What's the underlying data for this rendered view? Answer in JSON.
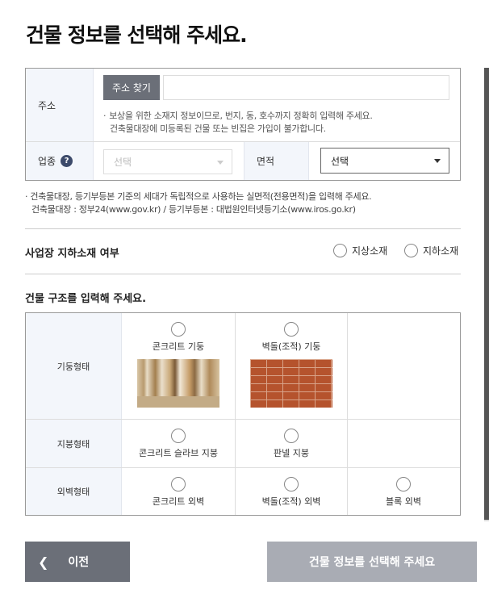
{
  "page": {
    "title": "건물 정보를 선택해 주세요."
  },
  "address": {
    "label": "주소",
    "search_button": "주소 찾기",
    "input_value": "",
    "notes": [
      "보상을 위한 소재지 정보이므로, 번지, 동, 호수까지 정확히 입력해 주세요.",
      "건축물대장에 미등록된 건물 또는 빈집은 가입이 불가합니다."
    ]
  },
  "industry": {
    "label": "업종",
    "help_icon": "question-circle-icon",
    "select_value": "선택"
  },
  "area": {
    "label": "면적",
    "select_value": "선택"
  },
  "area_note": [
    "건축물대장, 등기부등본 기준의 세대가 독립적으로 사용하는 실면적(전용면적)을 입력해 주세요.",
    "건축물대장 : 정부24(www.gov.kr) / 등기부등본 : 대법원인터넷등기소(www.iros.go.kr)"
  ],
  "basement": {
    "title": "사업장 지하소재 여부",
    "options": [
      "지상소재",
      "지하소재"
    ]
  },
  "structure": {
    "title": "건물 구조를 입력해 주세요.",
    "rows": [
      {
        "label": "기둥형태",
        "options": [
          "콘크리트 기둥",
          "벽돌(조적) 기둥"
        ]
      },
      {
        "label": "지붕형태",
        "options": [
          "콘크리트 슬라브 지붕",
          "판넬 지붕"
        ]
      },
      {
        "label": "외벽형태",
        "options": [
          "콘크리트 외벽",
          "벽돌(조적) 외벽",
          "블록 외벽"
        ]
      }
    ]
  },
  "footer": {
    "prev_label": "이전",
    "prev_icon": "chevron-left-icon",
    "next_label": "건물 정보를 선택해 주세요"
  },
  "colors": {
    "button_dark": "#6b6f78",
    "button_disabled": "#a9acb4",
    "label_bg": "#f3f6fb",
    "help_icon": "#3c4a6a"
  }
}
